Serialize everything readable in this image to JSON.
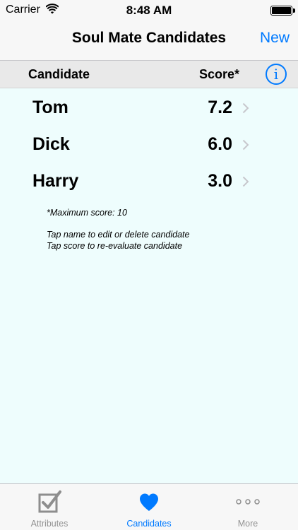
{
  "status": {
    "carrier": "Carrier",
    "time": "8:48 AM"
  },
  "nav": {
    "title": "Soul Mate Candidates",
    "new_label": "New"
  },
  "columns": {
    "candidate": "Candidate",
    "score": "Score*",
    "info": "i"
  },
  "candidates": [
    {
      "name": "Tom",
      "score": "7.2"
    },
    {
      "name": "Dick",
      "score": "6.0"
    },
    {
      "name": "Harry",
      "score": "3.0"
    }
  ],
  "notes": {
    "max_score": "*Maximum score: 10",
    "edit_hint": "Tap name to edit or delete candidate",
    "score_hint": "Tap score to re-evaluate candidate"
  },
  "tabs": [
    {
      "label": "Attributes",
      "icon": "checkbox-icon"
    },
    {
      "label": "Candidates",
      "icon": "heart-icon",
      "active": true
    },
    {
      "label": "More",
      "icon": "more-dots-icon"
    }
  ],
  "colors": {
    "accent": "#007aff",
    "background": "#eefdfd"
  }
}
